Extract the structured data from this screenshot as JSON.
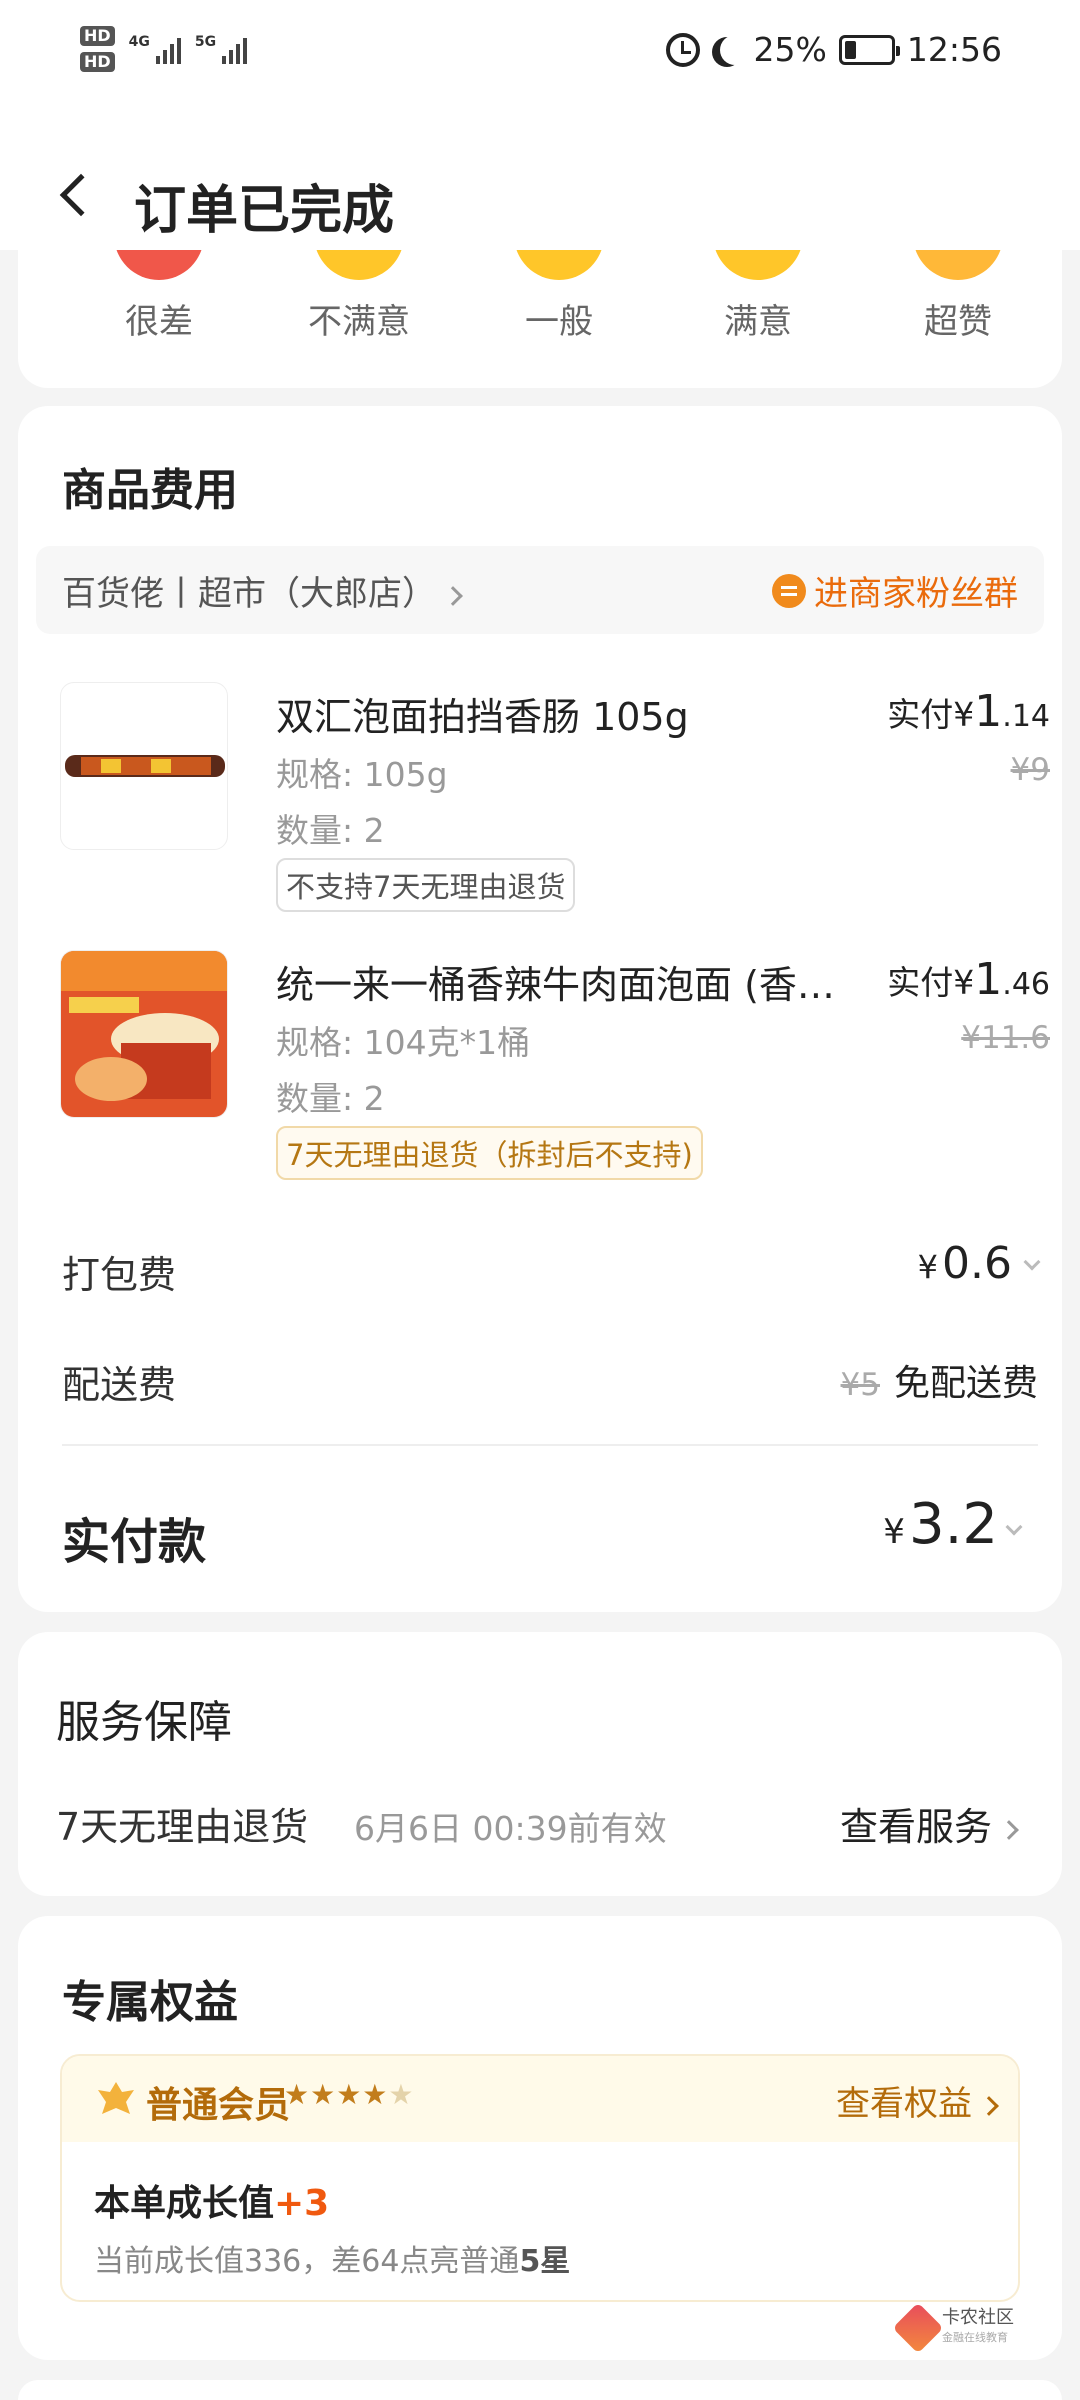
{
  "status_bar": {
    "time": "12:56",
    "battery": "25%",
    "battery_level": 0.25,
    "hd1": "HD",
    "hd2": "HD",
    "sig1": "4G",
    "sig2": "5G"
  },
  "header": {
    "title": "订单已完成"
  },
  "rating": {
    "items": [
      {
        "label": "很差",
        "color": "#f0574a"
      },
      {
        "label": "不满意",
        "color": "#ffc629"
      },
      {
        "label": "一般",
        "color": "#ffc629"
      },
      {
        "label": "满意",
        "color": "#ffc629"
      },
      {
        "label": "超赞",
        "color": "#ffb838"
      }
    ]
  },
  "cost": {
    "title": "商品费用",
    "shop_name": "百货佬丨超市（大郎店）",
    "fan_group": "进商家粉丝群",
    "items": [
      {
        "name": "双汇泡面拍挡香肠 105g",
        "spec": "规格: 105g",
        "qty": "数量: 2",
        "tag": "不支持7天无理由退货",
        "paid_prefix": "实付¥",
        "paid_int": "1",
        "paid_dec": ".14",
        "orig": "¥9"
      },
      {
        "name": "统一来一桶香辣牛肉面泡面 (香辣牛肉面)",
        "spec": "规格: 104克*1桶",
        "qty": "数量: 2",
        "tag": "7天无理由退货（拆封后不支持)",
        "paid_prefix": "实付¥",
        "paid_int": "1",
        "paid_dec": ".46",
        "orig": "¥11.6"
      }
    ],
    "packing_label": "打包费",
    "packing_currency": "¥",
    "packing_value": "0.6",
    "shipping_label": "配送费",
    "shipping_orig": "¥5",
    "shipping_value": "免配送费",
    "total_label": "实付款",
    "total_currency": "¥",
    "total_value": "3.2"
  },
  "service": {
    "title": "服务保障",
    "name": "7天无理由退货",
    "date": "6月6日 00:39前有效",
    "link": "查看服务"
  },
  "benefit": {
    "title": "专属权益",
    "member_name": "普通会员",
    "stars_on": "★★★★",
    "stars_off": "★",
    "link": "查看权益",
    "growth_label": "本单成长值",
    "growth_plus": "+3",
    "growth_sub_prefix": "当前成长值336，差64点亮普通",
    "growth_sub_bold": "5星"
  },
  "watermark": {
    "title": "卡农社区",
    "sub": "金融在线教育"
  }
}
